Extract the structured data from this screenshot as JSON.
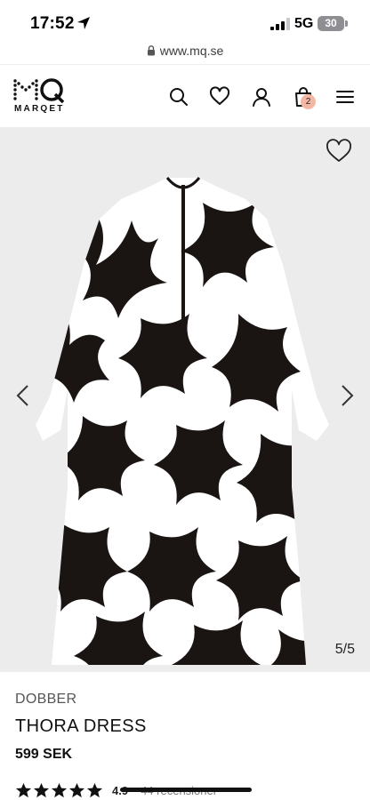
{
  "status_bar": {
    "time": "17:52",
    "network": "5G",
    "battery": "30"
  },
  "browser": {
    "url": "www.mq.se"
  },
  "header": {
    "logo_mark": "MQ",
    "logo_text": "MARQET",
    "cart_count": "2",
    "icons": [
      "search-icon",
      "heart-icon",
      "user-icon",
      "bag-icon",
      "menu-icon"
    ]
  },
  "gallery": {
    "counter": "5/5"
  },
  "product": {
    "brand": "DOBBER",
    "name": "THORA DRESS",
    "price": "599 SEK",
    "rating_value": "4.9",
    "rating_stars": 5,
    "reviews": "44 recensioner"
  },
  "colors": {
    "badge": "#f4b7a3",
    "gallery_bg": "#ececec",
    "text": "#1a1a1a"
  }
}
